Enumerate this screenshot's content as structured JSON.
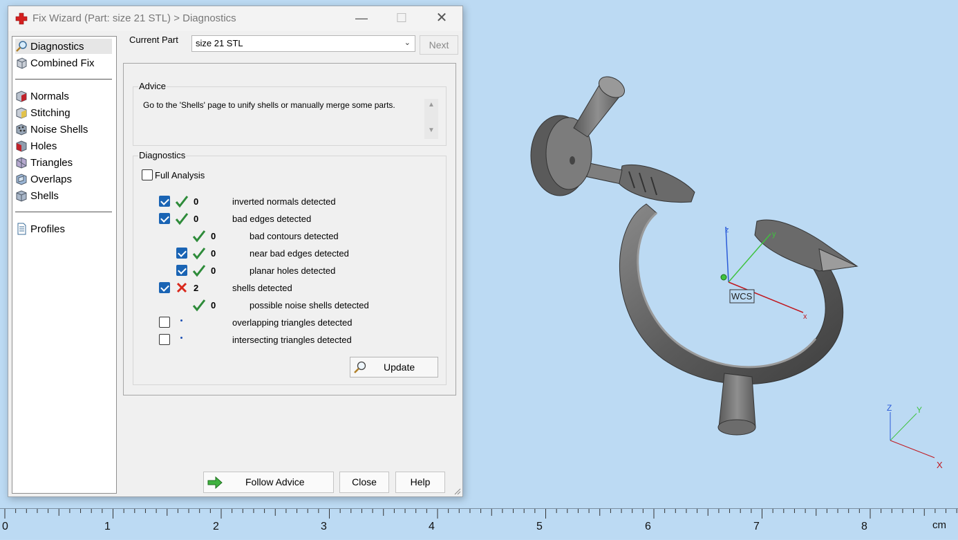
{
  "window": {
    "title": "Fix Wizard (Part: size 21 STL) > Diagnostics",
    "minimize_glyph": "—",
    "maximize_glyph": "☐",
    "close_glyph": "✕"
  },
  "nav": {
    "items": [
      {
        "label": "Diagnostics",
        "icon": "magnifier-icon",
        "selected": true
      },
      {
        "label": "Combined Fix",
        "icon": "combined-fix-icon"
      },
      {
        "label": "Normals",
        "icon": "normals-icon"
      },
      {
        "label": "Stitching",
        "icon": "stitching-icon"
      },
      {
        "label": "Noise Shells",
        "icon": "noise-shells-icon"
      },
      {
        "label": "Holes",
        "icon": "holes-icon"
      },
      {
        "label": "Triangles",
        "icon": "triangles-icon"
      },
      {
        "label": "Overlaps",
        "icon": "overlaps-icon"
      },
      {
        "label": "Shells",
        "icon": "shells-icon"
      },
      {
        "label": "Profiles",
        "icon": "profiles-icon"
      }
    ]
  },
  "current_part": {
    "label": "Current Part",
    "value": "size 21 STL",
    "next_label": "Next"
  },
  "advice": {
    "title": "Advice",
    "text": "Go to the 'Shells' page to unify shells or manually merge some parts."
  },
  "diagnostics": {
    "title": "Diagnostics",
    "full_analysis_label": "Full Analysis",
    "full_analysis_checked": false,
    "rows": [
      {
        "checkbox": true,
        "checked": true,
        "status": "ok",
        "count": "0",
        "label": "inverted normals detected"
      },
      {
        "checkbox": true,
        "checked": true,
        "status": "ok",
        "count": "0",
        "label": "bad edges detected"
      },
      {
        "checkbox": false,
        "checked": false,
        "status": "ok",
        "count": "0",
        "label": "bad contours detected"
      },
      {
        "checkbox": true,
        "checked": true,
        "status": "ok",
        "count": "0",
        "label": "near bad edges detected"
      },
      {
        "checkbox": true,
        "checked": true,
        "status": "ok",
        "count": "0",
        "label": "planar holes detected"
      },
      {
        "checkbox": true,
        "checked": true,
        "status": "error",
        "count": "2",
        "label": "shells detected"
      },
      {
        "checkbox": false,
        "checked": false,
        "status": "ok",
        "count": "0",
        "label": "possible noise shells detected"
      },
      {
        "checkbox": true,
        "checked": false,
        "status": "pending",
        "count": "",
        "label": "overlapping triangles detected"
      },
      {
        "checkbox": true,
        "checked": false,
        "status": "pending",
        "count": "",
        "label": "intersecting triangles detected"
      }
    ],
    "update_label": "Update"
  },
  "buttons": {
    "follow_advice": "Follow Advice",
    "close": "Close",
    "help": "Help"
  },
  "viewport": {
    "wcs_label": "WCS",
    "axis_labels": {
      "x": "x",
      "y": "y",
      "z": "z"
    },
    "corner_axis_labels": {
      "x": "X",
      "y": "Y",
      "z": "Z"
    }
  },
  "ruler": {
    "labels": [
      "0",
      "1",
      "2",
      "3",
      "4",
      "5",
      "6",
      "7",
      "8"
    ],
    "unit": "cm"
  },
  "colors": {
    "viewport_bg": "#bcdaf3",
    "check_blue": "#1a64b4",
    "ok_green": "#2e8b3a",
    "error_red": "#d9281c",
    "axis_red": "#c0181f",
    "axis_green": "#3fc23f",
    "axis_blue": "#2a5ad8"
  }
}
